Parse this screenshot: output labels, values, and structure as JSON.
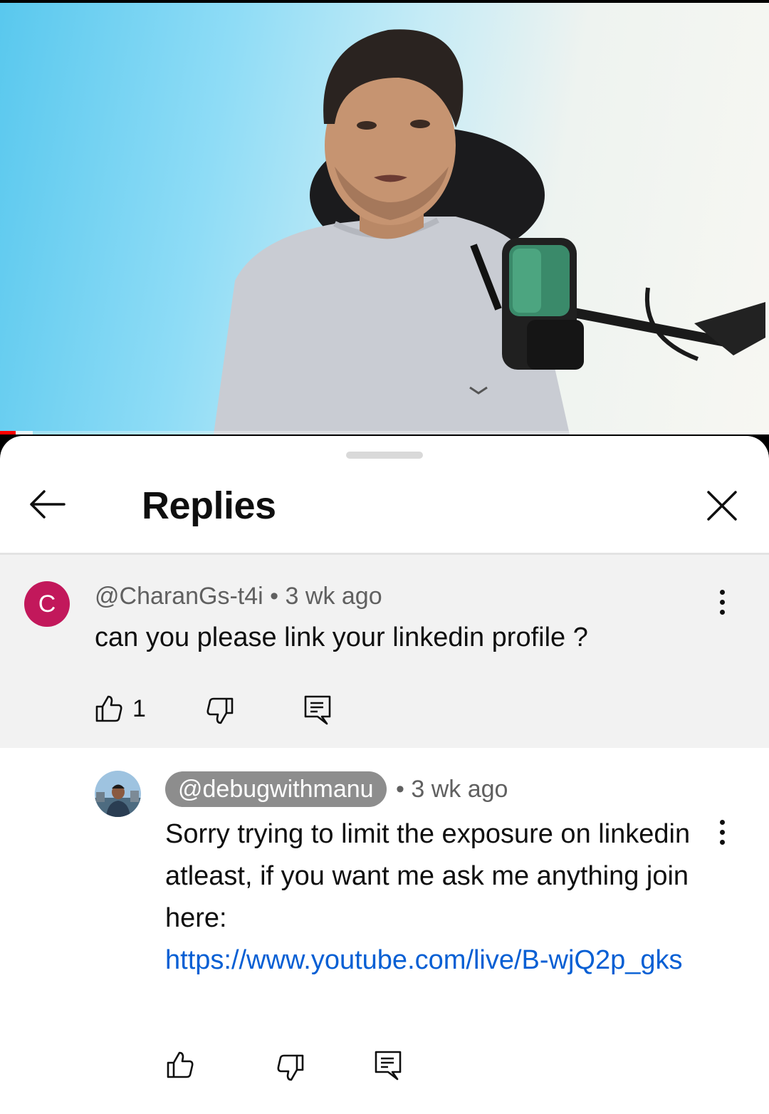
{
  "video": {
    "progress_fraction": 0.02
  },
  "sheet": {
    "title": "Replies"
  },
  "parent_comment": {
    "avatar_letter": "C",
    "avatar_color": "#c2185b",
    "author": "@CharanGs-t4i",
    "separator": "•",
    "time": "3 wk ago",
    "text": "can you please link your linkedin profile ?",
    "like_count": "1"
  },
  "reply": {
    "author": "@debugwithmanu",
    "separator": "•",
    "time": "3 wk ago",
    "text": "Sorry trying to limit the exposure on linkedin atleast, if you want me ask me anything join here:",
    "link": "https://www.youtube.com/live/B-wjQ2p_gks"
  },
  "icons": {
    "back": "arrow-left-icon",
    "close": "close-icon",
    "like": "thumbs-up-icon",
    "dislike": "thumbs-down-icon",
    "reply": "comment-reply-icon",
    "more": "more-vertical-icon"
  },
  "colors": {
    "link": "#065fd4",
    "author_chip_bg": "#8d8d8d",
    "parent_bg": "#f2f2f2",
    "progress": "#ff0000"
  }
}
